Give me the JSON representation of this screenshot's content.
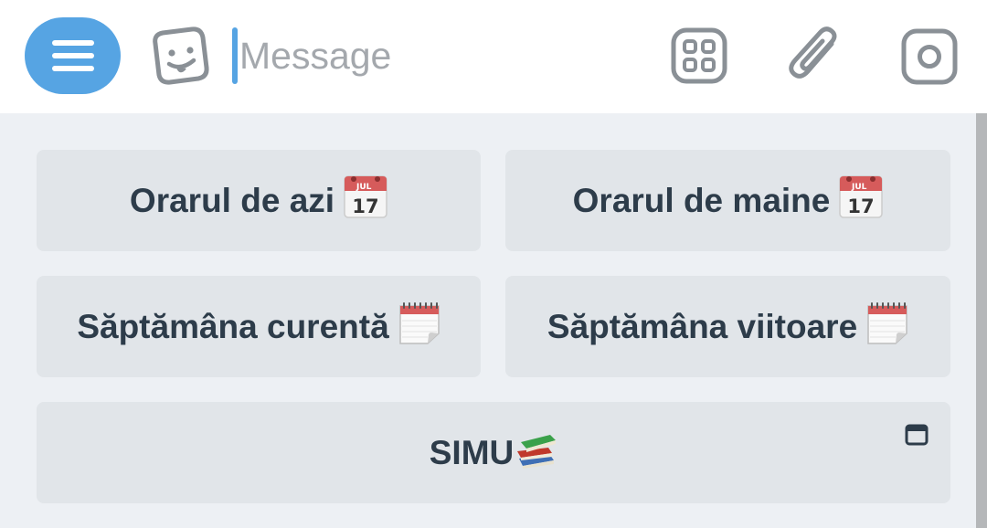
{
  "input_bar": {
    "placeholder": "Message",
    "value": "",
    "icons": [
      "menu-icon",
      "sticker-icon",
      "apps-icon",
      "paperclip-icon",
      "camera-icon"
    ],
    "menu_color": "#56a4e3"
  },
  "keyboard": {
    "row1": [
      {
        "label": "Orarul de azi",
        "icon": "tear-off-calendar-emoji"
      },
      {
        "label": "Orarul de maine",
        "icon": "tear-off-calendar-emoji"
      }
    ],
    "row2": [
      {
        "label": "Săptămâna curentă",
        "icon": "spiral-calendar-emoji"
      },
      {
        "label": "Săptămâna viitoare",
        "icon": "spiral-calendar-emoji"
      }
    ],
    "row3": [
      {
        "label": "SIMU",
        "icon": "books-emoji",
        "badge_icon": "web-app-icon"
      }
    ],
    "calendar_emoji": {
      "month": "JUL",
      "day": "17"
    }
  }
}
